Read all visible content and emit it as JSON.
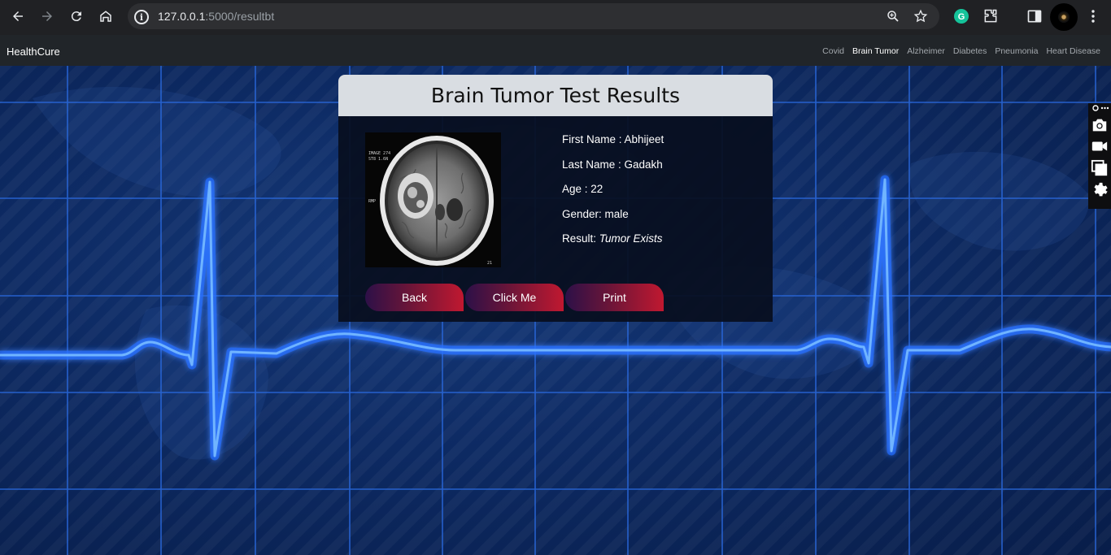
{
  "browser": {
    "url_host": "127.0.0.1",
    "url_path": ":5000/resultbt"
  },
  "navbar": {
    "brand": "HealthCure",
    "links": [
      "Covid",
      "Brain Tumor",
      "Alzheimer",
      "Diabetes",
      "Pneumonia",
      "Heart Disease"
    ],
    "active_link": "Brain Tumor"
  },
  "card": {
    "title": "Brain Tumor Test Results",
    "first_name_label": "First Name : ",
    "first_name": "Abhijeet",
    "last_name_label": "Last Name : ",
    "last_name": "Gadakh",
    "age_label": "Age : ",
    "age": "22",
    "gender_label": "Gender: ",
    "gender": "male",
    "result_label": "Result: ",
    "result": "Tumor Exists"
  },
  "buttons": {
    "back": "Back",
    "click_me": "Click Me",
    "print": "Print"
  },
  "colors": {
    "chrome_bg": "#202124",
    "navbar_bg": "#212529",
    "card_header_bg": "#d9dde2",
    "button_gradient_start": "#2d1048",
    "button_gradient_end": "#c01830",
    "ecg_line": "#2f8cff"
  },
  "icons": {
    "browser": [
      "back-arrow-icon",
      "forward-arrow-icon",
      "reload-icon",
      "home-icon",
      "site-info-icon",
      "zoom-icon",
      "bookmark-star-icon",
      "grammarly-icon",
      "extensions-puzzle-icon",
      "side-panel-icon",
      "profile-avatar",
      "more-vert-icon"
    ],
    "side_toolbar": [
      "pin-icon",
      "more-icon",
      "camera-icon",
      "video-icon",
      "screens-icon",
      "gear-icon"
    ]
  }
}
